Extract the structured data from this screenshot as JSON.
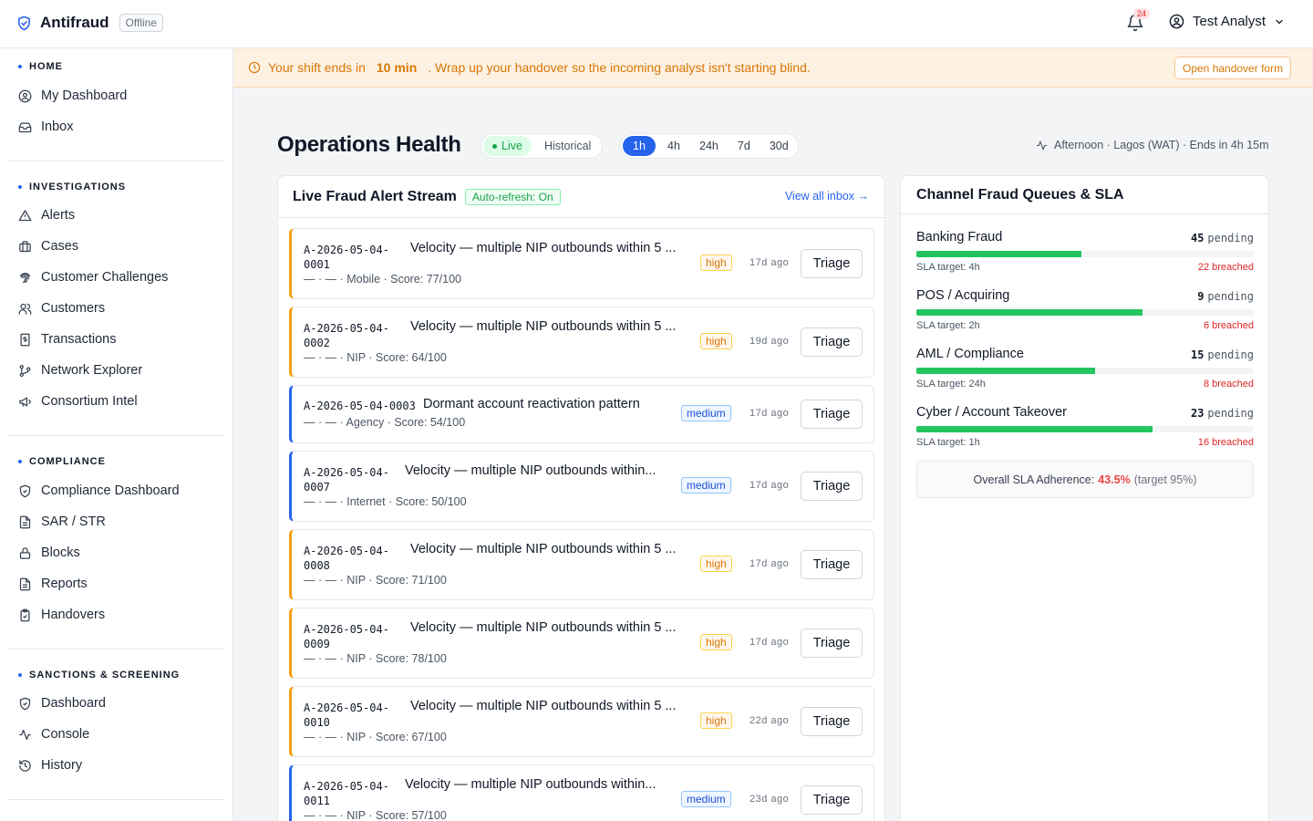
{
  "app": {
    "name": "Antifraud",
    "status_badge": "Offline"
  },
  "header": {
    "notification_count": "24",
    "user_name": "Test Analyst"
  },
  "sidebar": {
    "sections": [
      {
        "title": "HOME",
        "items": [
          {
            "label": "My Dashboard",
            "icon": "user-circle-icon"
          },
          {
            "label": "Inbox",
            "icon": "inbox-icon"
          }
        ]
      },
      {
        "title": "INVESTIGATIONS",
        "items": [
          {
            "label": "Alerts",
            "icon": "warning-icon"
          },
          {
            "label": "Cases",
            "icon": "briefcase-icon"
          },
          {
            "label": "Customer Challenges",
            "icon": "fingerprint-icon"
          },
          {
            "label": "Customers",
            "icon": "users-icon"
          },
          {
            "label": "Transactions",
            "icon": "receipt-icon"
          },
          {
            "label": "Network Explorer",
            "icon": "network-icon"
          },
          {
            "label": "Consortium Intel",
            "icon": "megaphone-icon"
          }
        ]
      },
      {
        "title": "COMPLIANCE",
        "items": [
          {
            "label": "Compliance Dashboard",
            "icon": "shield-check-icon"
          },
          {
            "label": "SAR / STR",
            "icon": "document-icon"
          },
          {
            "label": "Blocks",
            "icon": "lock-icon"
          },
          {
            "label": "Reports",
            "icon": "document-icon"
          },
          {
            "label": "Handovers",
            "icon": "clipboard-check-icon"
          }
        ]
      },
      {
        "title": "SANCTIONS & SCREENING",
        "items": [
          {
            "label": "Dashboard",
            "icon": "shield-check-icon"
          },
          {
            "label": "Console",
            "icon": "activity-icon"
          },
          {
            "label": "History",
            "icon": "history-icon"
          }
        ]
      }
    ]
  },
  "banner": {
    "text_before": "Your shift ends in",
    "highlight": "10 min",
    "text_after": ". Wrap up your handover so the incoming analyst isn't starting blind.",
    "button": "Open handover form"
  },
  "main": {
    "title": "Operations Health",
    "mode_toggle": {
      "live": "Live",
      "historical": "Historical",
      "selected": "Live"
    },
    "ranges": [
      "1h",
      "4h",
      "24h",
      "7d",
      "30d"
    ],
    "selected_range": "1h",
    "shift_info": "Afternoon · Lagos (WAT) · Ends in 4h 15m"
  },
  "alert_stream": {
    "title": "Live Fraud Alert Stream",
    "auto_refresh": "Auto-refresh: On",
    "view_all": "View all inbox →",
    "triage_label": "Triage",
    "alerts": [
      {
        "id_line1": "A-2026-05-04-",
        "id_line2": "0001",
        "title": "Velocity — multiple NIP outbounds within 5 ...",
        "meta": "— · — · Mobile · Score: 77/100",
        "severity": "high",
        "age": "17d ago"
      },
      {
        "id_line1": "A-2026-05-04-",
        "id_line2": "0002",
        "title": "Velocity — multiple NIP outbounds within 5 ...",
        "meta": "— · — · NIP · Score: 64/100",
        "severity": "high",
        "age": "19d ago"
      },
      {
        "id_line1": "A-2026-05-04-0003",
        "id_line2": "",
        "title": "Dormant account reactivation pattern",
        "meta": "— · — · Agency · Score: 54/100",
        "severity": "medium",
        "age": "17d ago"
      },
      {
        "id_line1": "A-2026-05-04-",
        "id_line2": "0007",
        "title": "Velocity — multiple NIP outbounds within...",
        "meta": "— · — · Internet · Score: 50/100",
        "severity": "medium",
        "age": "17d ago"
      },
      {
        "id_line1": "A-2026-05-04-",
        "id_line2": "0008",
        "title": "Velocity — multiple NIP outbounds within 5 ...",
        "meta": "— · — · NIP · Score: 71/100",
        "severity": "high",
        "age": "17d ago"
      },
      {
        "id_line1": "A-2026-05-04-",
        "id_line2": "0009",
        "title": "Velocity — multiple NIP outbounds within 5 ...",
        "meta": "— · — · NIP · Score: 78/100",
        "severity": "high",
        "age": "17d ago"
      },
      {
        "id_line1": "A-2026-05-04-",
        "id_line2": "0010",
        "title": "Velocity — multiple NIP outbounds within 5 ...",
        "meta": "— · — · NIP · Score: 67/100",
        "severity": "high",
        "age": "22d ago"
      },
      {
        "id_line1": "A-2026-05-04-",
        "id_line2": "0011",
        "title": "Velocity — multiple NIP outbounds within...",
        "meta": "— · — · NIP · Score: 57/100",
        "severity": "medium",
        "age": "23d ago"
      }
    ]
  },
  "queues": {
    "title": "Channel Fraud Queues & SLA",
    "pending_label": "pending",
    "items": [
      {
        "name": "Banking Fraud",
        "pending": "45",
        "sla_target": "SLA target: 4h",
        "breached": "22 breached",
        "progress": 0.49
      },
      {
        "name": "POS / Acquiring",
        "pending": "9",
        "sla_target": "SLA target: 2h",
        "breached": "6 breached",
        "progress": 0.67
      },
      {
        "name": "AML / Compliance",
        "pending": "15",
        "sla_target": "SLA target: 24h",
        "breached": "8 breached",
        "progress": 0.53
      },
      {
        "name": "Cyber / Account Takeover",
        "pending": "23",
        "sla_target": "SLA target: 1h",
        "breached": "16 breached",
        "progress": 0.7
      }
    ],
    "overall_label": "Overall SLA Adherence:",
    "overall_value": "43.5%",
    "overall_target": "(target 95%)"
  },
  "colors": {
    "accent": "#2563eb",
    "high": "#f59e0b",
    "medium": "#2563eb",
    "progress": "#22c55e",
    "breach": "#dc2626",
    "banner_bg": "#fdf1e2"
  }
}
